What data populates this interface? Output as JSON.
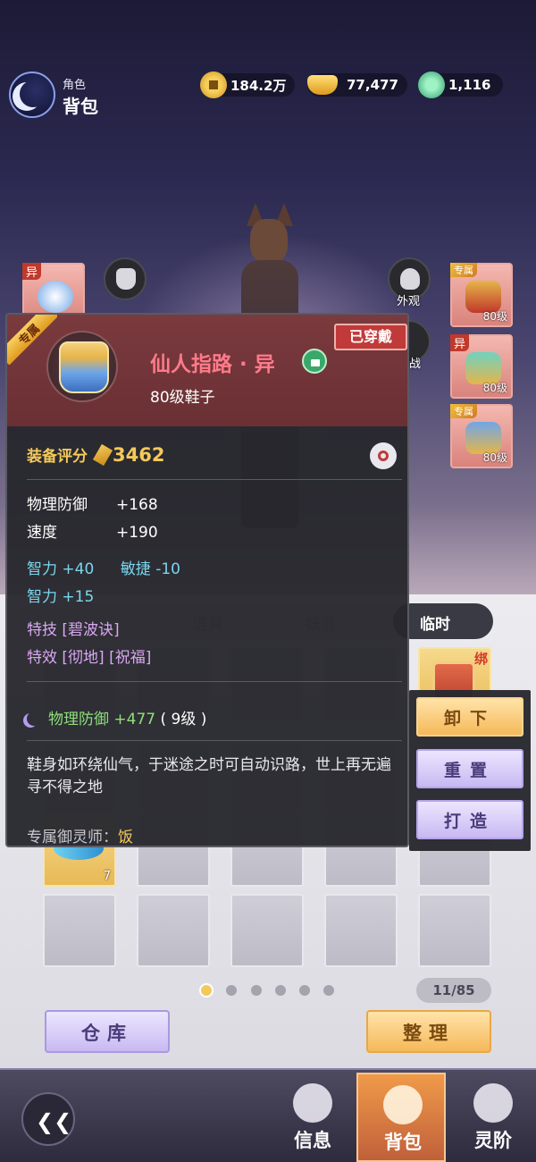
{
  "header": {
    "subtitle": "角色",
    "title": "背包"
  },
  "currencies": [
    {
      "icon": "coin-icon",
      "value": "184.2万"
    },
    {
      "icon": "gold-ingot-icon",
      "value": "77,477"
    },
    {
      "icon": "jade-icon",
      "value": "1,116"
    }
  ],
  "left_slot": {
    "tag": "异"
  },
  "right_slots": [
    {
      "tag": "专属",
      "level": "80级"
    },
    {
      "tag": "异",
      "level": "80级"
    },
    {
      "tag": "专属",
      "level": "80级"
    }
  ],
  "buttons": {
    "appearance": "外观",
    "battle_partial": "战"
  },
  "tabs": [
    "道具",
    "妖灵",
    "临时"
  ],
  "tooltip": {
    "ribbon": "专属",
    "status": "已穿戴",
    "name": "仙人指路 · 异",
    "type": "80级鞋子",
    "score_label": "装备评分",
    "score": "3462",
    "stats": [
      {
        "label": "物理防御",
        "value": "+168"
      },
      {
        "label": "速度",
        "value": "+190"
      }
    ],
    "bonus_row1": [
      {
        "label": "智力",
        "value": "+40"
      },
      {
        "label": "敏捷",
        "value": "-10"
      }
    ],
    "bonus_row2": {
      "label": "智力",
      "value": "+15"
    },
    "skill": {
      "label": "特技",
      "value": "[碧波诀]"
    },
    "effect": {
      "label": "特效",
      "value": "[彻地] [祝福]"
    },
    "spirit": {
      "label": "物理防御",
      "value": "+477",
      "level": "( 9级 )"
    },
    "description": "鞋身如环绕仙气，于迷途之时可自动识路，世上再无遍寻不得之地",
    "owner_label": "专属御灵师：",
    "owner_value": "饭"
  },
  "menu": {
    "unequip": "卸下",
    "reset": "重置",
    "forge": "打造"
  },
  "bag": {
    "bind_tag": "绑",
    "stack_count": "7",
    "page_count": "11/85",
    "pages": 6,
    "current_page": 1,
    "warehouse": "仓库",
    "sort": "整理"
  },
  "nav": {
    "info": "信息",
    "bag": "背包",
    "spirit": "灵阶"
  },
  "colors": {
    "accent_gold": "#f4c95a",
    "name_red": "#ff7a8a",
    "status_red": "#c03a3a"
  }
}
